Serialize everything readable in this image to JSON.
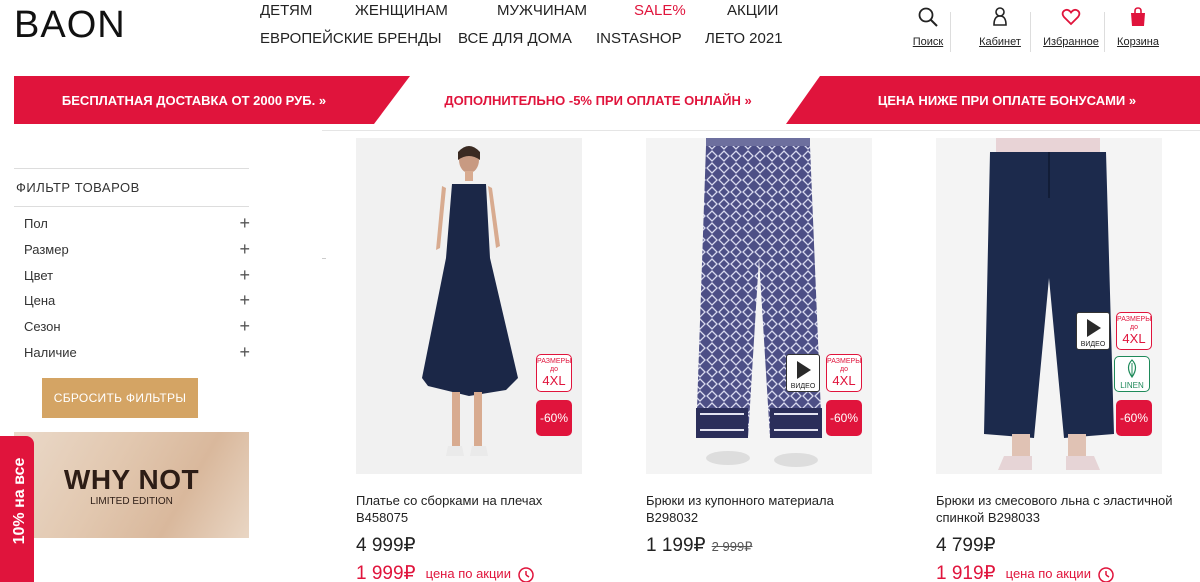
{
  "brand": {
    "logo_text": "BAON"
  },
  "nav": {
    "row1": [
      "ДЕТЯМ",
      "ЖЕНЩИНАМ",
      "МУЖЧИНАМ",
      "SALE%",
      "АКЦИИ"
    ],
    "row2": [
      "ЕВРОПЕЙСКИЕ БРЕНДЫ",
      "ВСЕ ДЛЯ ДОМА",
      "INSTASHOP",
      "ЛЕТО 2021"
    ]
  },
  "header_icons": [
    {
      "label": "Поиск",
      "icon": "search-icon"
    },
    {
      "label": "Кабинет",
      "icon": "user-icon"
    },
    {
      "label": "Избранное",
      "icon": "heart-icon"
    },
    {
      "label": "Корзина",
      "icon": "bag-icon"
    }
  ],
  "promo": {
    "left": "БЕСПЛАТНАЯ ДОСТАВКА ОТ 2000 РУБ. »",
    "middle": "ДОПОЛНИТЕЛЬНО -5% ПРИ ОПЛАТЕ ОНЛАЙН »",
    "right": "ЦЕНА НИЖЕ ПРИ ОПЛАТЕ БОНУСАМИ »"
  },
  "filters": {
    "title": "ФИЛЬТР ТОВАРОВ",
    "items": [
      "Пол",
      "Размер",
      "Цвет",
      "Цена",
      "Сезон",
      "Наличие"
    ],
    "reset_label": "СБРОСИТЬ ФИЛЬТРЫ"
  },
  "banner": {
    "title": "WHY NOT",
    "subtitle": "LIMITED EDITION"
  },
  "side_tab": "10% на все",
  "badges": {
    "sizes_top": "РАЗМЕРЫ",
    "sizes_small": "до",
    "sizes_big": "4XL",
    "video": "ВИДЕО",
    "linen": "LINEN"
  },
  "products": [
    {
      "name": "Платье со сборками на плечах B458075",
      "price": "4 999₽",
      "old_price": "",
      "sale_price": "1 999₽",
      "sale_note": "цена по акции",
      "discount": "-60%"
    },
    {
      "name": "Брюки из купонного материала B298032",
      "price": "1 199₽",
      "old_price": "2 999₽",
      "sale_price": "",
      "sale_note": "",
      "discount": "-60%"
    },
    {
      "name": "Брюки из смесового льна с эластичной спинкой B298033",
      "price": "4 799₽",
      "old_price": "",
      "sale_price": "1 919₽",
      "sale_note": "цена по акции",
      "discount": "-60%"
    }
  ],
  "colors": {
    "accent": "#e0143c",
    "gold": "#d4a464",
    "dark_navy": "#1b2747"
  }
}
